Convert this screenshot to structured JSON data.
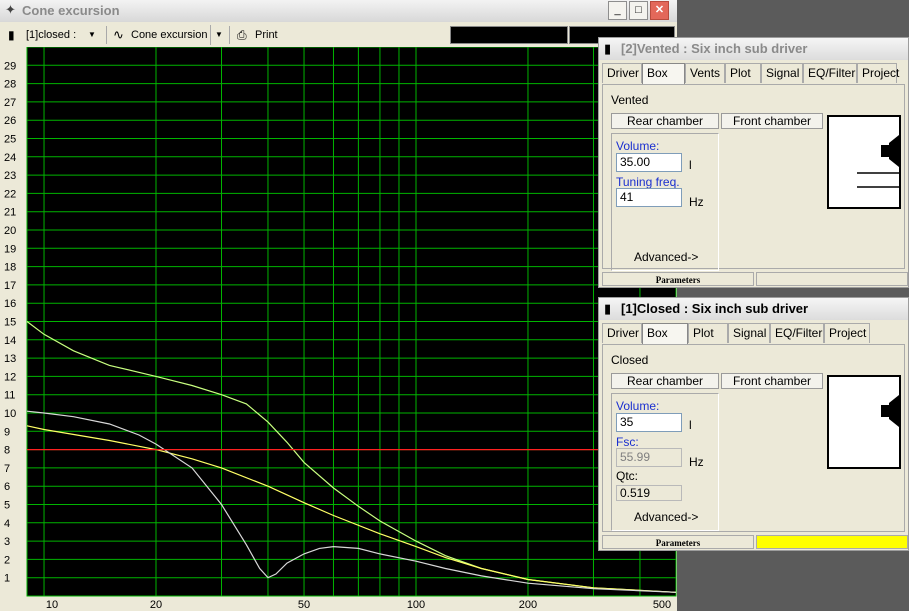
{
  "main_window": {
    "title": "Cone excursion",
    "toolbar": {
      "box_select": "[1]closed :",
      "plot_select": "Cone excursion",
      "print": "Print"
    }
  },
  "chart_data": {
    "type": "line",
    "x_scale": "log",
    "xlim": [
      9,
      500
    ],
    "ylim": [
      0,
      30
    ],
    "grid": true,
    "background": "#000000",
    "grid_color": "#00b400",
    "x_ticks": [
      "10",
      "20",
      "50",
      "100",
      "200",
      "500"
    ],
    "y_ticks": [
      "1",
      "2",
      "3",
      "4",
      "5",
      "6",
      "7",
      "8",
      "9",
      "10",
      "11",
      "12",
      "13",
      "14",
      "15",
      "16",
      "17",
      "18",
      "19",
      "20",
      "21",
      "22",
      "23",
      "24",
      "25",
      "26",
      "27",
      "28",
      "29"
    ],
    "series": [
      {
        "color": "#c8ff80",
        "points": [
          [
            9,
            15
          ],
          [
            10,
            14.3
          ],
          [
            12,
            13.4
          ],
          [
            15,
            12.6
          ],
          [
            20,
            12
          ],
          [
            25,
            11.5
          ],
          [
            30,
            11
          ],
          [
            35,
            10.5
          ],
          [
            40,
            9.5
          ],
          [
            45,
            8.4
          ],
          [
            50,
            7.3
          ],
          [
            60,
            5.9
          ],
          [
            70,
            4.9
          ],
          [
            80,
            4.1
          ],
          [
            100,
            3
          ],
          [
            120,
            2.2
          ],
          [
            150,
            1.5
          ],
          [
            200,
            0.9
          ],
          [
            300,
            0.45
          ],
          [
            500,
            0.2
          ]
        ]
      },
      {
        "color": "#ffff66",
        "points": [
          [
            9,
            9.3
          ],
          [
            10,
            9.1
          ],
          [
            15,
            8.5
          ],
          [
            20,
            8
          ],
          [
            25,
            7.5
          ],
          [
            30,
            7
          ],
          [
            40,
            6
          ],
          [
            50,
            5.1
          ],
          [
            60,
            4.4
          ],
          [
            80,
            3.4
          ],
          [
            100,
            2.7
          ],
          [
            120,
            2.1
          ],
          [
            150,
            1.5
          ],
          [
            200,
            0.9
          ],
          [
            300,
            0.45
          ],
          [
            500,
            0.2
          ]
        ]
      },
      {
        "color": "#d8d8d8",
        "points": [
          [
            9,
            10.1
          ],
          [
            10,
            10
          ],
          [
            12,
            9.8
          ],
          [
            15,
            9.4
          ],
          [
            18,
            8.8
          ],
          [
            20,
            8.3
          ],
          [
            25,
            7
          ],
          [
            30,
            5
          ],
          [
            35,
            2.8
          ],
          [
            38,
            1.5
          ],
          [
            40,
            1
          ],
          [
            42,
            1.2
          ],
          [
            45,
            1.8
          ],
          [
            50,
            2.3
          ],
          [
            55,
            2.6
          ],
          [
            60,
            2.7
          ],
          [
            70,
            2.6
          ],
          [
            80,
            2.3
          ],
          [
            100,
            1.9
          ],
          [
            120,
            1.5
          ],
          [
            150,
            1.1
          ],
          [
            200,
            0.7
          ],
          [
            300,
            0.4
          ],
          [
            500,
            0.2
          ]
        ]
      },
      {
        "color": "#ff2020",
        "points": [
          [
            9,
            8
          ],
          [
            500,
            8
          ]
        ]
      }
    ]
  },
  "vented_window": {
    "title": "[2]Vented : Six inch sub driver",
    "tabs": [
      "Driver",
      "Box",
      "Vents",
      "Plot",
      "Signal",
      "EQ/Filter",
      "Project"
    ],
    "active_tab": "Box",
    "box_type": "Vented",
    "rear_chamber": "Rear chamber",
    "front_chamber": "Front chamber",
    "volume_label": "Volume:",
    "volume_value": "35.00",
    "volume_unit": "l",
    "tuning_label": "Tuning freq.",
    "tuning_value": "41",
    "tuning_unit": "Hz",
    "advanced": "Advanced->",
    "status": "Parameters"
  },
  "closed_window": {
    "title": "[1]Closed : Six inch sub driver",
    "tabs": [
      "Driver",
      "Box",
      "Plot",
      "Signal",
      "EQ/Filter",
      "Project"
    ],
    "active_tab": "Box",
    "box_type": "Closed",
    "rear_chamber": "Rear chamber",
    "front_chamber": "Front chamber",
    "volume_label": "Volume:",
    "volume_value": "35",
    "volume_unit": "l",
    "fsc_label": "Fsc:",
    "fsc_value": "55.99",
    "fsc_unit": "Hz",
    "qtc_label": "Qtc:",
    "qtc_value": "0.519",
    "advanced": "Advanced->",
    "status": "Parameters",
    "status_color": "#ffff00"
  }
}
